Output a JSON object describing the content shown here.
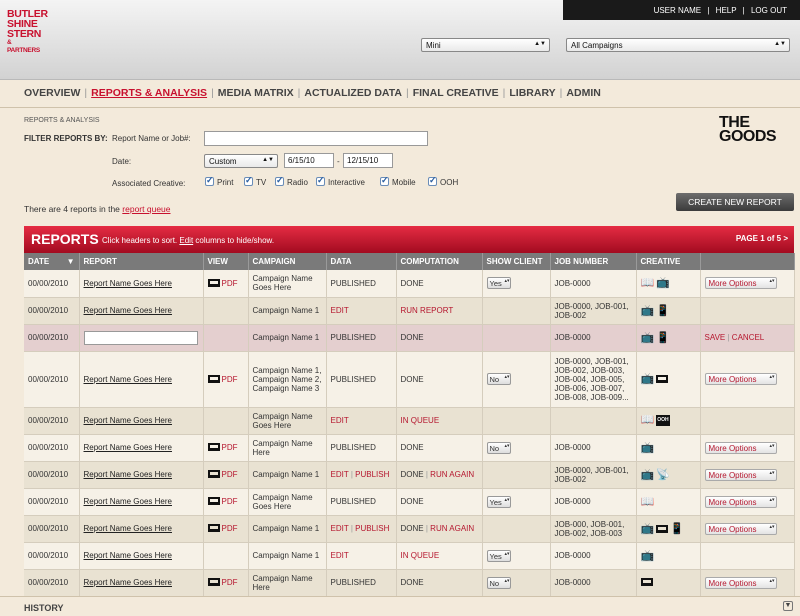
{
  "brand": {
    "line1": "BUTLER",
    "line2": "SHINE",
    "line3": "STERN",
    "line4": "& PARTNERS"
  },
  "topbar": {
    "user": "USER NAME",
    "sep": "|",
    "help": "HELP",
    "logout": "LOG OUT"
  },
  "selects": {
    "client": "Mini",
    "campaign": "All Campaigns"
  },
  "nav": [
    "OVERVIEW",
    "REPORTS & ANALYSIS",
    "MEDIA MATRIX",
    "ACTUALIZED DATA",
    "FINAL CREATIVE",
    "LIBRARY",
    "ADMIN"
  ],
  "nav_sep": "|",
  "breadcrumb": "REPORTS & ANALYSIS",
  "filter": {
    "title": "FILTER REPORTS BY:",
    "name_label": "Report Name or Job#:",
    "name_value": "",
    "date_label": "Date:",
    "date_type": "Custom",
    "date_from": "6/15/10",
    "date_dash": "-",
    "date_to": "12/15/10",
    "creative_label": "Associated Creative:",
    "creative_options": [
      "Print",
      "TV",
      "Radio",
      "Interactive",
      "Mobile",
      "OOH"
    ]
  },
  "goods_logo": {
    "line1": "THE",
    "line2": "GOODS"
  },
  "queue": {
    "text": "There are 4 reports in the",
    "link": "report queue"
  },
  "create_button": "CREATE NEW REPORT",
  "reports_bar": {
    "title": "REPORTS",
    "hint_pre": "Click headers to sort.",
    "hint_link": "Edit",
    "hint_post": "columns to hide/show.",
    "page": "PAGE 1 of 5 >"
  },
  "columns": [
    "DATE",
    "REPORT",
    "VIEW",
    "CAMPAIGN",
    "DATA",
    "COMPUTATION",
    "SHOW CLIENT",
    "JOB NUMBER",
    "CREATIVE",
    ""
  ],
  "sort_indicator": "▼",
  "rows": [
    {
      "date": "00/00/2010",
      "report": "Report Name Goes Here",
      "view": "PDF",
      "campaign": "Campaign Name Goes Here",
      "data": "PUBLISHED",
      "data2": "",
      "comp": "DONE",
      "comp2": "",
      "show": "Yes",
      "job": "JOB-0000",
      "action": "More Options"
    },
    {
      "date": "00/00/2010",
      "report": "Report Name Goes Here",
      "view": "",
      "campaign": "Campaign Name 1",
      "data": "EDIT",
      "data2": "",
      "comp": "RUN REPORT",
      "comp2": "",
      "show": "",
      "job": "JOB-0000, JOB-001, JOB-002",
      "action": ""
    },
    {
      "date": "00/00/2010",
      "report": "",
      "view": "",
      "campaign": "Campaign Name 1",
      "data": "PUBLISHED",
      "data2": "",
      "comp": "DONE",
      "comp2": "",
      "show": "",
      "job": "JOB-0000",
      "action_save": "SAVE",
      "action_sep": "|",
      "action_cancel": "CANCEL"
    },
    {
      "date": "00/00/2010",
      "report": "Report Name Goes Here",
      "view": "PDF",
      "campaign": "Campaign Name 1, Campaign Name 2, Campaign Name 3",
      "data": "PUBLISHED",
      "data2": "",
      "comp": "DONE",
      "comp2": "",
      "show": "No",
      "job": "JOB-0000, JOB-001, JOB-002, JOB-003, JOB-004, JOB-005, JOB-006, JOB-007, JOB-008, JOB-009...",
      "action": "More Options"
    },
    {
      "date": "00/00/2010",
      "report": "Report Name Goes Here",
      "view": "",
      "campaign": "Campaign Name Goes Here",
      "data": "EDIT",
      "data2": "",
      "comp": "IN QUEUE",
      "comp2": "",
      "show": "",
      "job": "",
      "action": ""
    },
    {
      "date": "00/00/2010",
      "report": "Report Name Goes Here",
      "view": "PDF",
      "campaign": "Campaign Name Here",
      "data": "PUBLISHED",
      "data2": "",
      "comp": "DONE",
      "comp2": "",
      "show": "No",
      "job": "JOB-0000",
      "action": "More Options"
    },
    {
      "date": "00/00/2010",
      "report": "Report Name Goes Here",
      "view": "PDF",
      "campaign": "Campaign Name 1",
      "data": "EDIT",
      "data2": "PUBLISH",
      "comp": "DONE",
      "comp2": "RUN AGAIN",
      "show": "",
      "job": "JOB-0000, JOB-001, JOB-002",
      "action": "More Options"
    },
    {
      "date": "00/00/2010",
      "report": "Report Name Goes Here",
      "view": "PDF",
      "campaign": "Campaign Name Goes Here",
      "data": "PUBLISHED",
      "data2": "",
      "comp": "DONE",
      "comp2": "",
      "show": "Yes",
      "job": "JOB-0000",
      "action": "More Options"
    },
    {
      "date": "00/00/2010",
      "report": "Report Name Goes Here",
      "view": "PDF",
      "campaign": "Campaign Name 1",
      "data": "EDIT",
      "data2": "PUBLISH",
      "comp": "DONE",
      "comp2": "RUN AGAIN",
      "show": "",
      "job": "JOB-000, JOB-001, JOB-002, JOB-003",
      "action": "More Options"
    },
    {
      "date": "00/00/2010",
      "report": "Report Name Goes Here",
      "view": "",
      "campaign": "Campaign Name 1",
      "data": "EDIT",
      "data2": "",
      "comp": "IN QUEUE",
      "comp2": "",
      "show": "Yes",
      "job": "JOB-0000",
      "action": ""
    },
    {
      "date": "00/00/2010",
      "report": "Report Name Goes Here",
      "view": "PDF",
      "campaign": "Campaign Name Here",
      "data": "PUBLISHED",
      "data2": "",
      "comp": "DONE",
      "comp2": "",
      "show": "No",
      "job": "JOB-0000",
      "action": "More Options"
    }
  ],
  "ooh_badge": "OOH",
  "history": "HISTORY",
  "colors": {
    "brand_red": "#c8102e",
    "background": "#f3eadb",
    "header_gray": "#7a7a7a"
  }
}
